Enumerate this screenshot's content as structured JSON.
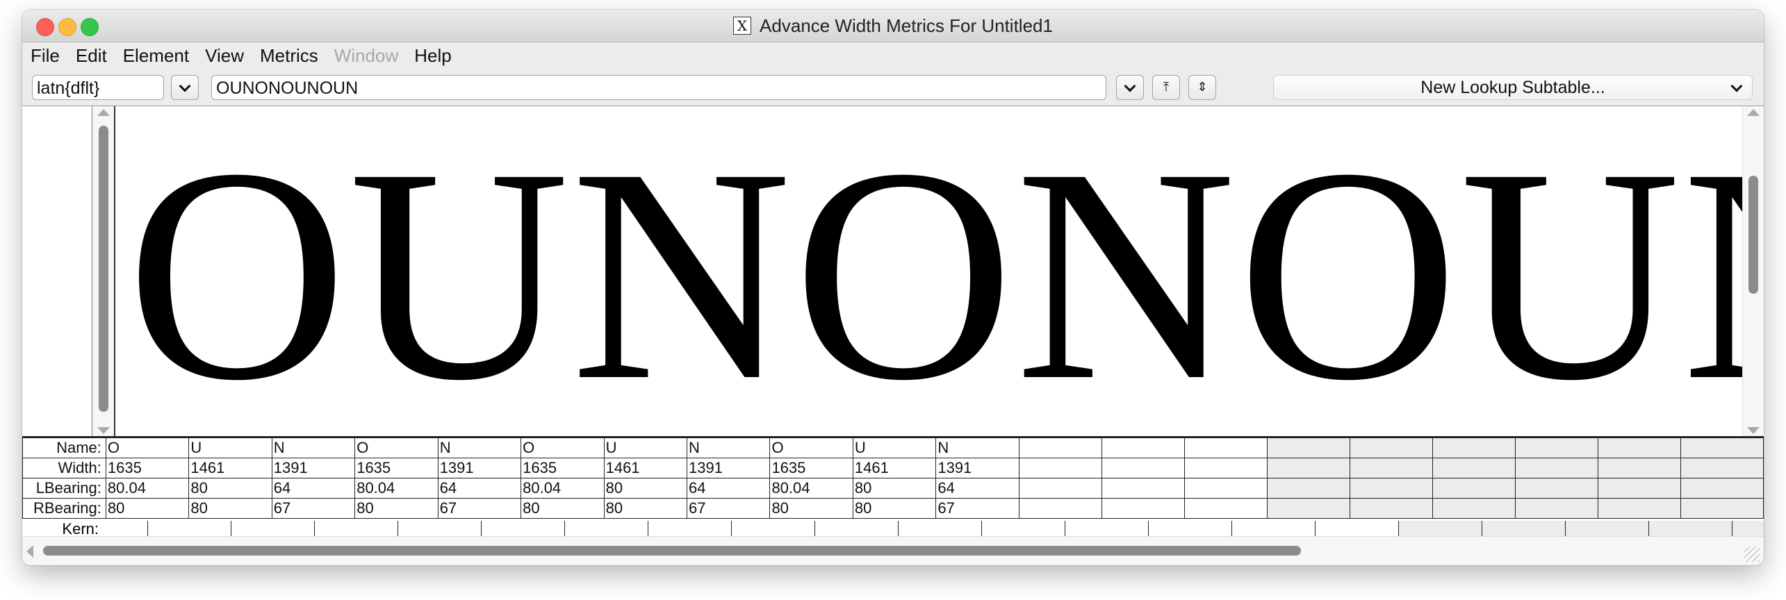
{
  "window": {
    "title": "Advance Width Metrics For Untitled1",
    "app_icon": "X"
  },
  "menu": [
    {
      "label": "File",
      "enabled": true
    },
    {
      "label": "Edit",
      "enabled": true
    },
    {
      "label": "Element",
      "enabled": true
    },
    {
      "label": "View",
      "enabled": true
    },
    {
      "label": "Metrics",
      "enabled": true
    },
    {
      "label": "Window",
      "enabled": false
    },
    {
      "label": "Help",
      "enabled": true
    }
  ],
  "toolbar": {
    "script_value": "latn{dflt}",
    "text_value": "OUNONOUNOUN",
    "lookup_label": "New Lookup Subtable..."
  },
  "preview_text": "OUNONOUNOUN",
  "metrics": {
    "row_labels": {
      "name": "Name:",
      "width": "Width:",
      "lbearing": "LBearing:",
      "rbearing": "RBearing:",
      "kern": "Kern:"
    },
    "glyphs": [
      {
        "name": "O",
        "width": "1635",
        "lbearing": "80.04",
        "rbearing": "80"
      },
      {
        "name": "U",
        "width": "1461",
        "lbearing": "80",
        "rbearing": "80"
      },
      {
        "name": "N",
        "width": "1391",
        "lbearing": "64",
        "rbearing": "67"
      },
      {
        "name": "O",
        "width": "1635",
        "lbearing": "80.04",
        "rbearing": "80"
      },
      {
        "name": "N",
        "width": "1391",
        "lbearing": "64",
        "rbearing": "67"
      },
      {
        "name": "O",
        "width": "1635",
        "lbearing": "80.04",
        "rbearing": "80"
      },
      {
        "name": "U",
        "width": "1461",
        "lbearing": "80",
        "rbearing": "80"
      },
      {
        "name": "N",
        "width": "1391",
        "lbearing": "64",
        "rbearing": "67"
      },
      {
        "name": "O",
        "width": "1635",
        "lbearing": "80.04",
        "rbearing": "80"
      },
      {
        "name": "U",
        "width": "1461",
        "lbearing": "80",
        "rbearing": "80"
      },
      {
        "name": "N",
        "width": "1391",
        "lbearing": "64",
        "rbearing": "67"
      }
    ],
    "empty_white_columns": 3,
    "empty_gray_columns": 6
  }
}
